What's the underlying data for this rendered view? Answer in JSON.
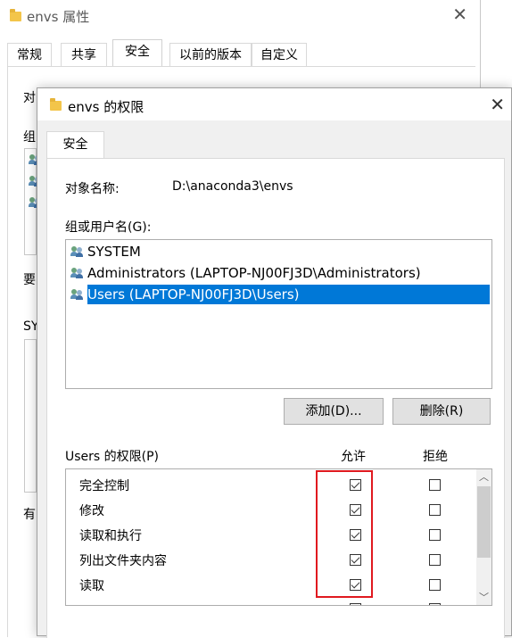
{
  "background_window": {
    "title": "envs 属性",
    "tabs": [
      "常规",
      "共享",
      "安全",
      "以前的版本",
      "自定义"
    ],
    "selected_tab": "安全",
    "partial_labels": [
      "对",
      "组",
      "要",
      "SY",
      "有"
    ]
  },
  "dialog": {
    "title": "envs 的权限",
    "tab": "安全",
    "object_name_label": "对象名称:",
    "object_name_value": "D:\\anaconda3\\envs",
    "group_label": "组或用户名(G):",
    "users": [
      {
        "name": "SYSTEM",
        "selected": false
      },
      {
        "name": "Administrators (LAPTOP-NJ00FJ3D\\Administrators)",
        "selected": false
      },
      {
        "name": "Users (LAPTOP-NJ00FJ3D\\Users)",
        "selected": true
      }
    ],
    "add_button": "添加(D)...",
    "remove_button": "删除(R)",
    "permissions_label": "Users 的权限(P)",
    "allow_header": "允许",
    "deny_header": "拒绝",
    "permissions": [
      {
        "name": "完全控制",
        "allow": true,
        "deny": false
      },
      {
        "name": "修改",
        "allow": true,
        "deny": false
      },
      {
        "name": "读取和执行",
        "allow": true,
        "deny": false
      },
      {
        "name": "列出文件夹内容",
        "allow": true,
        "deny": false
      },
      {
        "name": "读取",
        "allow": true,
        "deny": false
      }
    ],
    "scroll_up": "︿",
    "scroll_down": "﹀"
  },
  "colors": {
    "selection": "#0078d7",
    "highlight_box": "#e0191f"
  }
}
